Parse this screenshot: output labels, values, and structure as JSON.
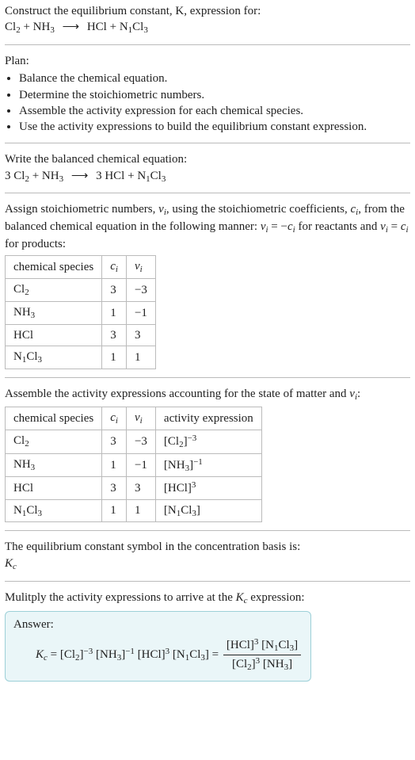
{
  "intro": {
    "line1": "Construct the equilibrium constant, K, expression for:",
    "eq_lhs_a": "Cl",
    "eq_lhs_a_sub": "2",
    "eq_lhs_b": "NH",
    "eq_lhs_b_sub": "3",
    "arrow": "⟶",
    "eq_rhs_a": "HCl",
    "eq_rhs_b": "N",
    "eq_rhs_b_sub1": "1",
    "eq_rhs_b_cl": "Cl",
    "eq_rhs_b_sub2": "3"
  },
  "plan": {
    "heading": "Plan:",
    "items": [
      "Balance the chemical equation.",
      "Determine the stoichiometric numbers.",
      "Assemble the activity expression for each chemical species.",
      "Use the activity expressions to build the equilibrium constant expression."
    ]
  },
  "balanced": {
    "heading": "Write the balanced chemical equation:",
    "c1": "3",
    "c3": "3"
  },
  "assign": {
    "line1_a": "Assign stoichiometric numbers, ",
    "nu": "ν",
    "nu_sub": "i",
    "line1_b": ", using the stoichiometric coefficients, ",
    "c": "c",
    "c_sub": "i",
    "line1_c": ", from the balanced chemical equation in the following manner: ",
    "rel1a": "ν",
    "rel1b": " = −",
    "rel1c": "c",
    "line1_d": " for reactants and ",
    "rel2a": "ν",
    "rel2b": " = ",
    "rel2c": "c",
    "line1_e": " for products:"
  },
  "table1": {
    "headers": [
      "chemical species",
      "cᵢ",
      "νᵢ"
    ],
    "rows": [
      {
        "sp_a": "Cl",
        "sp_sub": "2",
        "c": "3",
        "v": "−3"
      },
      {
        "sp_a": "NH",
        "sp_sub": "3",
        "c": "1",
        "v": "−1"
      },
      {
        "sp_a": "HCl",
        "sp_sub": "",
        "c": "3",
        "v": "3"
      },
      {
        "sp_a": "N",
        "sp_sub": "1",
        "sp_b": "Cl",
        "sp_sub2": "3",
        "c": "1",
        "v": "1"
      }
    ]
  },
  "assemble": {
    "line1_a": "Assemble the activity expressions accounting for the state of matter and ",
    "nu": "ν",
    "nu_sub": "i",
    "line1_b": ":"
  },
  "table2": {
    "headers": [
      "chemical species",
      "cᵢ",
      "νᵢ",
      "activity expression"
    ],
    "rows": [
      {
        "sp": "Cl₂",
        "c": "3",
        "v": "−3",
        "act_base": "[Cl",
        "act_sub": "2",
        "act_close": "]",
        "act_sup": "−3"
      },
      {
        "sp": "NH₃",
        "c": "1",
        "v": "−1",
        "act_base": "[NH",
        "act_sub": "3",
        "act_close": "]",
        "act_sup": "−1"
      },
      {
        "sp": "HCl",
        "c": "3",
        "v": "3",
        "act_base": "[HCl]",
        "act_sub": "",
        "act_close": "",
        "act_sup": "3"
      },
      {
        "sp": "N₁Cl₃",
        "c": "1",
        "v": "1",
        "act_base": "[N",
        "act_sub": "1",
        "act_mid": "Cl",
        "act_sub2": "3",
        "act_close": "]",
        "act_sup": ""
      }
    ]
  },
  "kc_symbol": {
    "line": "The equilibrium constant symbol in the concentration basis is:",
    "K": "K",
    "Ksub": "c"
  },
  "multiply": {
    "line_a": "Mulitply the activity expressions to arrive at the ",
    "K": "K",
    "Ksub": "c",
    "line_b": " expression:"
  },
  "answer": {
    "label": "Answer:",
    "lhs_K": "K",
    "lhs_Ksub": "c",
    "eq": " = ",
    "t1_base": "[Cl",
    "t1_sub": "2",
    "t1_close": "]",
    "t1_sup": "−3",
    "t2_base": "[NH",
    "t2_sub": "3",
    "t2_close": "]",
    "t2_sup": "−1",
    "t3_base": "[HCl]",
    "t3_sup": "3",
    "t4_base": "[N",
    "t4_sub": "1",
    "t4_mid": "Cl",
    "t4_sub2": "3",
    "t4_close": "]",
    "eq2": " = ",
    "num_a_base": "[HCl]",
    "num_a_sup": "3",
    "num_b_base": "[N",
    "num_b_sub": "1",
    "num_b_mid": "Cl",
    "num_b_sub2": "3",
    "num_b_close": "]",
    "den_a_base": "[Cl",
    "den_a_sub": "2",
    "den_a_close": "]",
    "den_a_sup": "3",
    "den_b_base": "[NH",
    "den_b_sub": "3",
    "den_b_close": "]"
  },
  "chart_data": {
    "type": "table",
    "tables": [
      {
        "title": "stoichiometric numbers",
        "columns": [
          "chemical species",
          "c_i",
          "nu_i"
        ],
        "rows": [
          [
            "Cl2",
            3,
            -3
          ],
          [
            "NH3",
            1,
            -1
          ],
          [
            "HCl",
            3,
            3
          ],
          [
            "N1Cl3",
            1,
            1
          ]
        ]
      },
      {
        "title": "activity expressions",
        "columns": [
          "chemical species",
          "c_i",
          "nu_i",
          "activity expression"
        ],
        "rows": [
          [
            "Cl2",
            3,
            -3,
            "[Cl2]^-3"
          ],
          [
            "NH3",
            1,
            -1,
            "[NH3]^-1"
          ],
          [
            "HCl",
            3,
            3,
            "[HCl]^3"
          ],
          [
            "N1Cl3",
            1,
            1,
            "[N1Cl3]"
          ]
        ]
      }
    ]
  }
}
